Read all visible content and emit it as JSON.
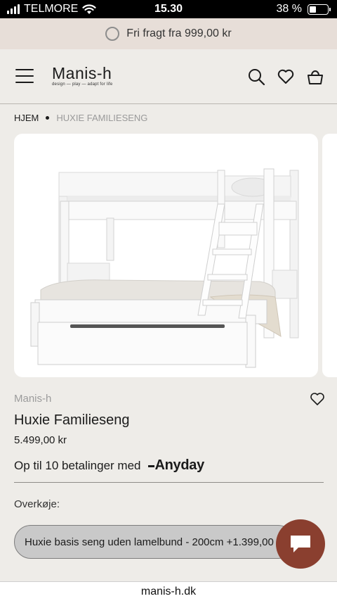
{
  "status_bar": {
    "carrier": "TELMORE",
    "time": "15.30",
    "battery": "38 %",
    "battery_level": 0.38
  },
  "promo": {
    "text": "Fri fragt fra 999,00 kr"
  },
  "header": {
    "logo_name": "Manis-h",
    "logo_tagline": "design — play — adapt for life",
    "icons": [
      "menu-icon",
      "search-icon",
      "heart-icon",
      "bag-icon"
    ]
  },
  "breadcrumb": {
    "home": "HJEM",
    "current": "HUXIE FAMILIESENG"
  },
  "product": {
    "brand": "Manis-h",
    "name": "Huxie Familieseng",
    "price": "5.499,00 kr",
    "installments_text": "Op til 10 betalinger med",
    "installments_provider": "Anyday",
    "option_label": "Overkøje:",
    "option_selected": "Huxie basis seng uden lamelbund - 200cm +1.399,00 kr"
  },
  "url": "manis-h.dk",
  "colors": {
    "background": "#eeece8",
    "promo_bar": "#e7ded8",
    "chat_button": "#8a3f2f",
    "select_bg": "#c9c9c9"
  }
}
